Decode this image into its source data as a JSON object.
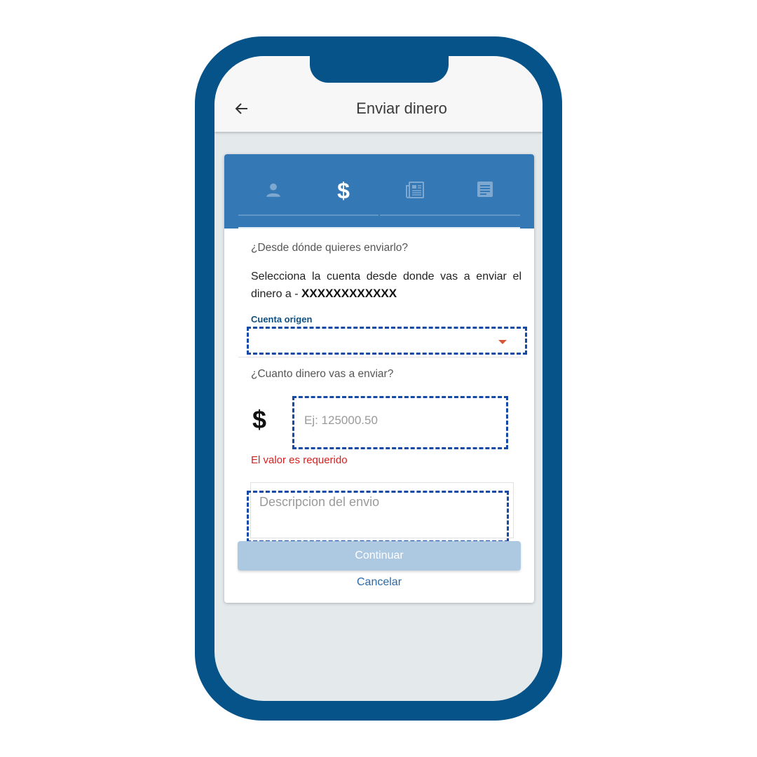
{
  "header": {
    "title": "Enviar dinero",
    "back_icon": "arrow-left-icon"
  },
  "steps": [
    {
      "icon": "person-icon",
      "active": false
    },
    {
      "icon": "dollar-icon",
      "label": "$",
      "active": true
    },
    {
      "icon": "newspaper-icon",
      "active": false
    },
    {
      "icon": "document-icon",
      "active": false
    }
  ],
  "form": {
    "question_origin": "¿Desde dónde quieres enviarlo?",
    "instruction": "Selecciona la cuenta desde donde vas a enviar el dinero a - ",
    "recipient_account": "XXXXXXXXXXXX",
    "origin_label": "Cuenta origen",
    "origin_value": "",
    "question_amount": "¿Cuanto dinero vas a enviar?",
    "currency_symbol": "$",
    "amount_placeholder": "Ej: 125000.50",
    "amount_value": "",
    "amount_error": "El valor es requerido",
    "description_placeholder": "Descripcion del envio",
    "description_value": ""
  },
  "actions": {
    "continue_label": "Continuar",
    "cancel_label": "Cancelar"
  },
  "colors": {
    "phone_frame": "#06538a",
    "card_header": "#3479b5",
    "highlight_dashed": "#1549a6",
    "error": "#d32020",
    "continue_disabled": "#adc8e1",
    "link": "#2c6aa6"
  }
}
